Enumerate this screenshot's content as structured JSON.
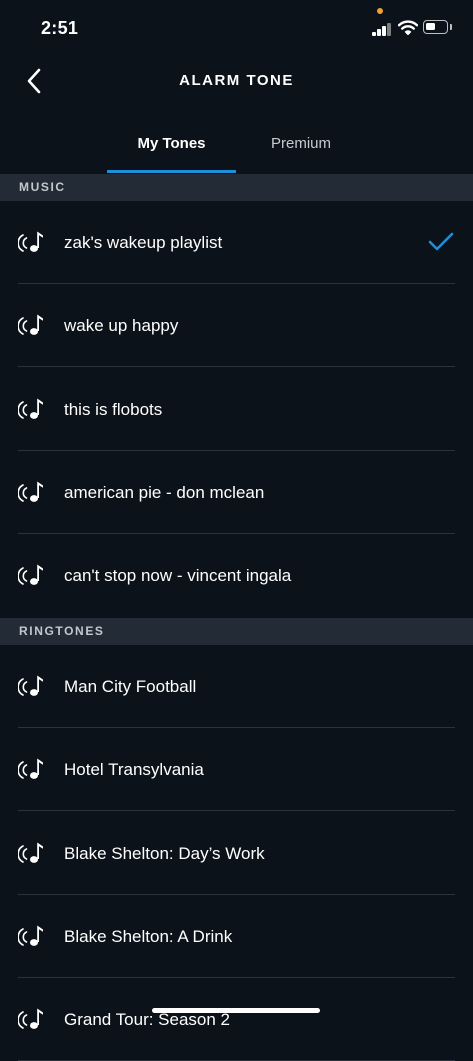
{
  "status_bar": {
    "time": "2:51"
  },
  "header": {
    "title": "ALARM TONE"
  },
  "tabs": [
    {
      "label": "My Tones",
      "selected": true
    },
    {
      "label": "Premium",
      "selected": false
    }
  ],
  "sections": [
    {
      "title": "MUSIC",
      "items": [
        {
          "label": "zak's wakeup playlist",
          "selected": true
        },
        {
          "label": "wake up happy"
        },
        {
          "label": "this is flobots"
        },
        {
          "label": "american pie - don mclean"
        },
        {
          "label": "can't stop now - vincent ingala"
        }
      ]
    },
    {
      "title": "RINGTONES",
      "items": [
        {
          "label": "Man City Football"
        },
        {
          "label": "Hotel Transylvania"
        },
        {
          "label": "Blake Shelton: Day’s Work"
        },
        {
          "label": "Blake Shelton: A Drink"
        },
        {
          "label": "Grand Tour: Season 2"
        }
      ]
    }
  ],
  "colors": {
    "accent": "#1e8fd8",
    "background": "#0b1219",
    "section_bg": "#232c36"
  }
}
